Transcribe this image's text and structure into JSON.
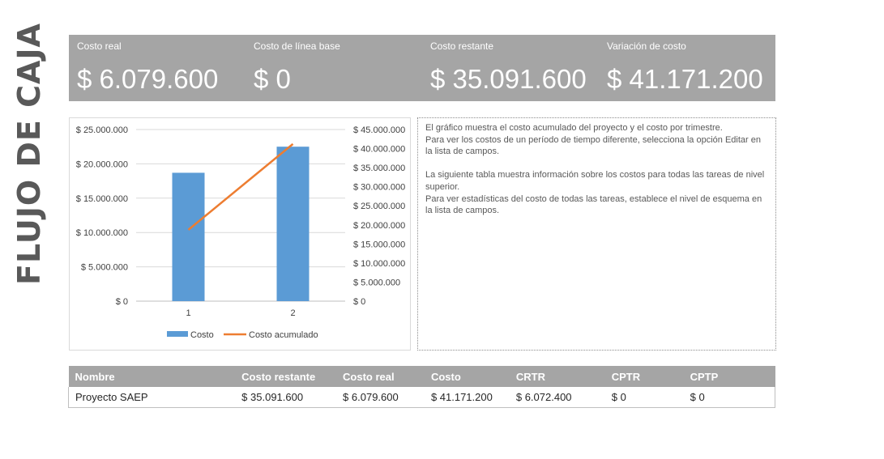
{
  "page": {
    "vertical_title": "FLUJO DE CAJA"
  },
  "kpis": [
    {
      "label": "Costo real",
      "value": "$ 6.079.600"
    },
    {
      "label": "Costo de línea base",
      "value": "$ 0"
    },
    {
      "label": "Costo restante",
      "value": "$ 35.091.600"
    },
    {
      "label": "Variación de costo",
      "value": "$ 41.171.200"
    }
  ],
  "chart_data": {
    "type": "bar",
    "categories": [
      "1",
      "2"
    ],
    "series": [
      {
        "name": "Costo",
        "type": "bar",
        "axis": "left",
        "values": [
          18700000,
          22500000
        ],
        "color": "#5b9bd5"
      },
      {
        "name": "Costo acumulado",
        "type": "line",
        "axis": "right",
        "values": [
          18700000,
          41200000
        ],
        "color": "#ed7d31"
      }
    ],
    "left_axis": {
      "ylim": [
        0,
        25000000
      ],
      "ticks": [
        "$ 0",
        "$ 5.000.000",
        "$ 10.000.000",
        "$ 15.000.000",
        "$ 20.000.000",
        "$ 25.000.000"
      ]
    },
    "right_axis": {
      "ylim": [
        0,
        45000000
      ],
      "ticks": [
        "$ 0",
        "$ 5.000.000",
        "$ 10.000.000",
        "$ 15.000.000",
        "$ 20.000.000",
        "$ 25.000.000",
        "$ 30.000.000",
        "$ 35.000.000",
        "$ 40.000.000",
        "$ 45.000.000"
      ]
    },
    "grid": true,
    "legend": "bottom"
  },
  "notes": {
    "p1": "El gráfico muestra el costo acumulado del proyecto y el costo por trimestre.",
    "p2": "Para ver los costos de un período de tiempo diferente, selecciona la opción Editar en la lista de campos.",
    "p3": "La siguiente tabla muestra información sobre los costos para todas las tareas de nivel superior.",
    "p4": "Para ver estadísticas del costo de todas las tareas, establece el nivel de esquema en la lista de campos."
  },
  "table": {
    "headers": [
      "Nombre",
      "Costo restante",
      "Costo real",
      "Costo",
      "CRTR",
      "CPTR",
      "CPTP"
    ],
    "rows": [
      [
        "Proyecto SAEP",
        "$ 35.091.600",
        "$ 6.079.600",
        "$ 41.171.200",
        "$ 6.072.400",
        "$ 0",
        "$ 0"
      ]
    ]
  }
}
